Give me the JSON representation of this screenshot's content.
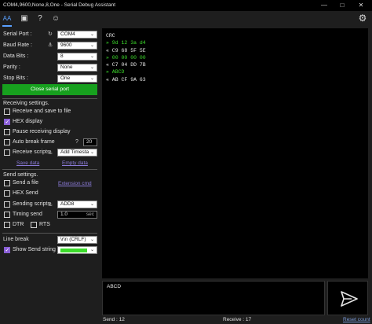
{
  "window": {
    "title": "COM4,9600,None,8,One - Serial Debug Assistant",
    "minimize": "—",
    "maximize": "□",
    "close": "✕"
  },
  "toolbar": {
    "icons": [
      "font-settings-icon",
      "image-icon",
      "help-icon",
      "emoji-icon",
      "gear-icon"
    ],
    "font_glyph": "AΑ",
    "help_glyph": "?",
    "emoji_glyph": "☺",
    "gear_glyph": "⚙",
    "image_glyph": "▣"
  },
  "serial": {
    "port_label": "Serial Port :",
    "port_value": "COM4",
    "baud_label": "Baud Rate :",
    "baud_value": "9600",
    "databits_label": "Data Bits :",
    "databits_value": "8",
    "parity_label": "Parity :",
    "parity_value": "None",
    "stopbits_label": "Stop Bits :",
    "stopbits_value": "One",
    "close_button": "Close serial port"
  },
  "receiving": {
    "title": "Receiving settings.",
    "save_to_file": "Receive and save to file",
    "hex_display": "HEX display",
    "pause": "Pause receiving display",
    "auto_break": "Auto break frame",
    "auto_break_value": "20",
    "receive_scripts": "Receive scripts",
    "receive_scripts_value": "Add Timesta",
    "save_data": "Save data",
    "empty_data": "Empty data"
  },
  "sending": {
    "title": "Send settings.",
    "send_file": "Send a file",
    "extension_cmd": "Extension cmd",
    "hex_send": "HEX Send",
    "sending_scripts": "Sending scripts",
    "sending_scripts_value": "ADD8",
    "timing_send": "Timing send",
    "timing_value": "1.0",
    "timing_unit": "sec",
    "dtr": "DTR",
    "rts": "RTS",
    "line_break_label": "Line break",
    "line_break_value": "\\r\\n (CRLF)",
    "show_send_string": "Show Send string",
    "send_string_color": "#3ddc2c"
  },
  "receive_area": {
    "lines": [
      {
        "text": "CRC",
        "color": "#e6e6e6"
      },
      {
        "text": "» 9d 12 3a d4",
        "color": "#3ddc2c"
      },
      {
        "text": "« C9 68 5F 5E",
        "color": "#e6e6e6"
      },
      {
        "text": "» 00 00 00 00",
        "color": "#3ddc2c"
      },
      {
        "text": "« C7 04 DD 7B",
        "color": "#e6e6e6"
      },
      {
        "text": "» ABCD",
        "color": "#3ddc2c"
      },
      {
        "text": "« AB CF 9A 63",
        "color": "#e6e6e6"
      }
    ]
  },
  "send_area": {
    "value": "ABCD"
  },
  "status": {
    "send": "Send : 12",
    "receive": "Receive : 17",
    "reset": "Reset count"
  }
}
